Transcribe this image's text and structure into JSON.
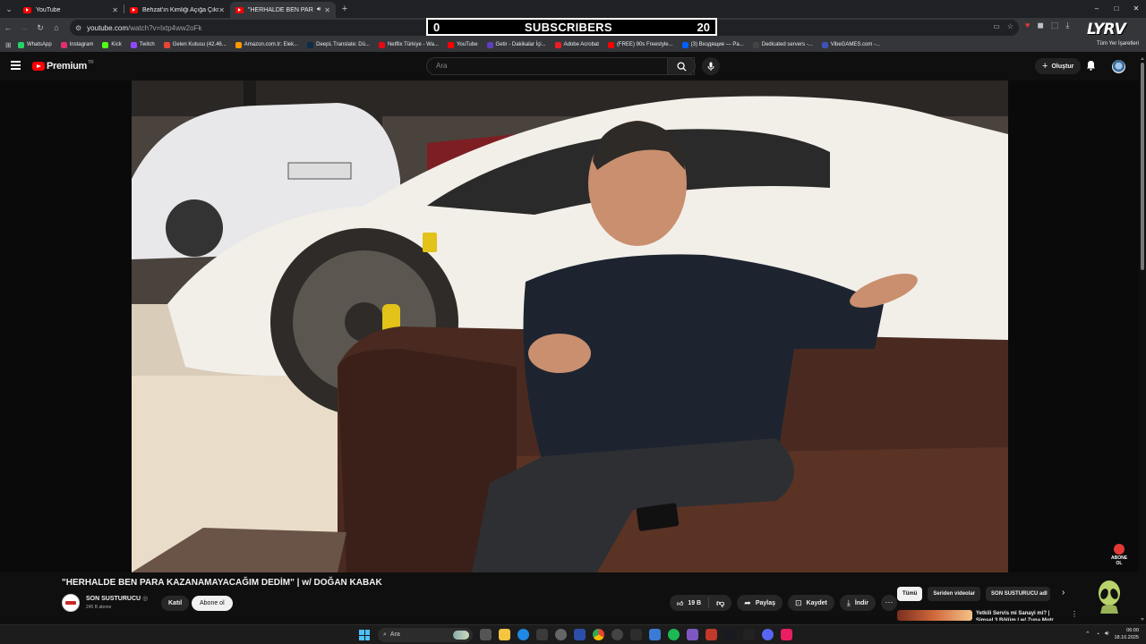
{
  "browser": {
    "tabs": [
      {
        "title": "YouTube",
        "active": false
      },
      {
        "title": "Behzat'ın Kimliği Açığa Çıkmadı",
        "active": false
      },
      {
        "title": "\"HERHALDE BEN PARA KA…",
        "active": true
      }
    ],
    "url_host": "youtube.com",
    "url_path": "/watch?v=lxtp4ww2oFk",
    "bookmarks": [
      {
        "label": "WhatsApp",
        "color": "#25d366"
      },
      {
        "label": "Instagram",
        "color": "#e1306c"
      },
      {
        "label": "Kick",
        "color": "#53fc18"
      },
      {
        "label": "Twitch",
        "color": "#9146ff"
      },
      {
        "label": "Gelen Kutusu (42.46...",
        "color": "#ea4335"
      },
      {
        "label": "Amazon.com.tr: Elek...",
        "color": "#ff9900"
      },
      {
        "label": "DeepL Translate: Dü...",
        "color": "#0f2b46"
      },
      {
        "label": "Netflix Türkiye - Wa...",
        "color": "#e50914"
      },
      {
        "label": "YouTube",
        "color": "#ff0000"
      },
      {
        "label": "Getir - Dakikalar İçi...",
        "color": "#5d3ebc"
      },
      {
        "label": "Adobe Acrobat",
        "color": "#ec1c24"
      },
      {
        "label": "(FREE) 90s Freestyle...",
        "color": "#ff0000"
      },
      {
        "label": "(3) Входящие — Pa...",
        "color": "#005ff9"
      },
      {
        "label": "Dedicated servers -...",
        "color": "#444444"
      },
      {
        "label": "VibeGAMES.com -...",
        "color": "#3f51b5"
      }
    ],
    "bookmarks_right": "Tüm Yer İşaretleri"
  },
  "overlay": {
    "sub_left": "0",
    "sub_label": "SUBSCRIBERS",
    "sub_right": "20",
    "brand": "LYRV"
  },
  "youtube": {
    "logo_text": "Premium",
    "region": "TR",
    "search_placeholder": "Ara",
    "create_label": "Oluştur"
  },
  "video": {
    "title": "\"HERHALDE BEN PARA KAZANAMAYACAĞIM DEDİM\" | w/ DOĞAN KABAK",
    "channel": "SON SUSTURUCU",
    "subscribers": "245 B abone",
    "join_label": "Katıl",
    "subscribe_label": "Abone ol",
    "likes": "19 B",
    "share_label": "Paylaş",
    "save_label": "Kaydet",
    "download_label": "İndir",
    "abone_badge": "ABONE OL"
  },
  "sidebar": {
    "chips": [
      "Tümü",
      "Seriden videolar",
      "SON SUSTURUCU adl"
    ],
    "rec_title": "Yetkili Servis mi Sanayi mi? | Simsel 3 Bölüm | w/ Zuna Motr"
  },
  "taskbar": {
    "search_label": "Ara",
    "time": "06:00",
    "date": "18.10.2025"
  }
}
